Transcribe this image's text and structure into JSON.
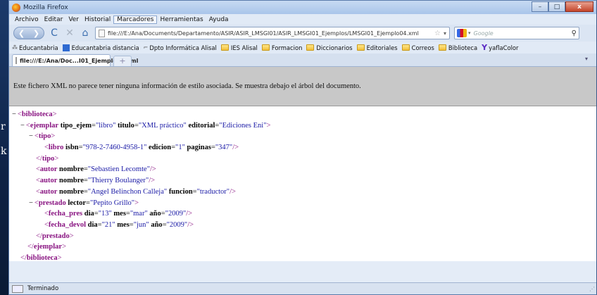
{
  "window": {
    "title": "Mozilla Firefox",
    "controls": {
      "minimize": "–",
      "maximize": "□",
      "close": "x"
    }
  },
  "left_strip": {
    "chars": [
      "r",
      "k"
    ]
  },
  "menu": [
    "Archivo",
    "Editar",
    "Ver",
    "Historial",
    "Marcadores",
    "Herramientas",
    "Ayuda"
  ],
  "nav": {
    "url": "file:///E:/Ana/Documents/Departamento/ASIR/ASIR_LMSGI01/ASIR_LMSGI01_Ejemplos/LMSGI01_Ejemplo04.xml",
    "search_placeholder": "Google",
    "back_glyph": "❮",
    "forward_glyph": "❯",
    "reload_glyph": "C",
    "stop_glyph": "✕",
    "home_glyph": "⌂",
    "star_glyph": "☆",
    "drop_glyph": "▾",
    "search_glyph": "⚲"
  },
  "bookmarks": [
    {
      "label": "Educantabria",
      "icon": "most-visited-icon"
    },
    {
      "label": "Educantabria distancia",
      "icon": "site-icon"
    },
    {
      "label": "Dpto Informática Alisal",
      "icon": "site-icon"
    },
    {
      "label": "IES Alisal",
      "icon": "folder-icon"
    },
    {
      "label": "Formacion",
      "icon": "folder-icon"
    },
    {
      "label": "Diccionarios",
      "icon": "folder-icon"
    },
    {
      "label": "Editoriales",
      "icon": "folder-icon"
    },
    {
      "label": "Correos",
      "icon": "folder-icon"
    },
    {
      "label": "Biblioteca",
      "icon": "folder-icon"
    },
    {
      "label": "yaflaColor",
      "icon": "yahoo-icon"
    }
  ],
  "bookmark_glyphs": {
    "most_visited": "⁂",
    "dash": "⌐",
    "yahoo": "Y"
  },
  "tab": {
    "label": "file:///E:/Ana/Doc...I01_Ejemplo04.xml",
    "new_tab": "+",
    "scroll": "▾"
  },
  "info_message": "Este fichero XML no parece tener ninguna información de estilo asociada. Se muestra debajo el árbol del documento.",
  "xml": {
    "collapser": "−",
    "biblioteca": "biblioteca",
    "ejemplar": {
      "tag": "ejemplar",
      "attrs": [
        {
          "name": "tipo_ejem",
          "value": "libro"
        },
        {
          "name": "titulo",
          "value": "XML práctico"
        },
        {
          "name": "editorial",
          "value": "Ediciones Eni"
        }
      ]
    },
    "tipo": "tipo",
    "libro": {
      "tag": "libro",
      "attrs": [
        {
          "name": "isbn",
          "value": "978-2-7460-4958-1"
        },
        {
          "name": "edicion",
          "value": "1"
        },
        {
          "name": "paginas",
          "value": "347"
        }
      ]
    },
    "autores": [
      {
        "tag": "autor",
        "attrs": [
          {
            "name": "nombre",
            "value": "Sebastien Lecomte"
          }
        ]
      },
      {
        "tag": "autor",
        "attrs": [
          {
            "name": "nombre",
            "value": "Thierry Boulanger"
          }
        ]
      },
      {
        "tag": "autor",
        "attrs": [
          {
            "name": "nombre",
            "value": "Angel Belinchon Calleja"
          },
          {
            "name": "funcion",
            "value": "traductor"
          }
        ]
      }
    ],
    "prestado": {
      "tag": "prestado",
      "attrs": [
        {
          "name": "lector",
          "value": "Pepito Grillo"
        }
      ]
    },
    "fecha_pres": {
      "tag": "fecha_pres",
      "attrs": [
        {
          "name": "dia",
          "value": "13"
        },
        {
          "name": "mes",
          "value": "mar"
        },
        {
          "name": "año",
          "value": "2009"
        }
      ]
    },
    "fecha_devol": {
      "tag": "fecha_devol",
      "attrs": [
        {
          "name": "dia",
          "value": "21"
        },
        {
          "name": "mes",
          "value": "jun"
        },
        {
          "name": "año",
          "value": "2009"
        }
      ]
    }
  },
  "status": {
    "text": "Terminado",
    "grip": "⋰"
  }
}
